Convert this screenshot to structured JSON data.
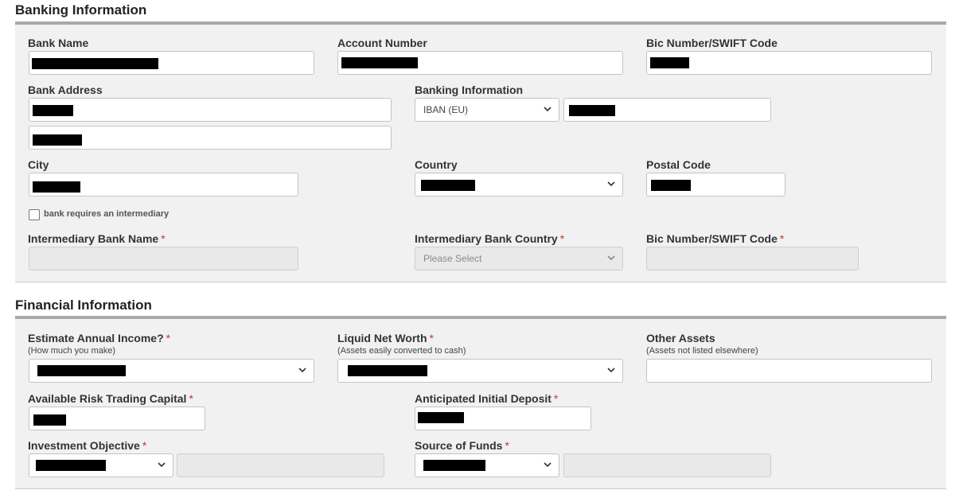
{
  "banking": {
    "title": "Banking Information",
    "bank_name_label": "Bank Name",
    "account_number_label": "Account Number",
    "bic_label": "Bic Number/SWIFT Code",
    "bank_address_label": "Bank Address",
    "banking_info_label": "Banking Information",
    "banking_info_type": "IBAN (EU)",
    "city_label": "City",
    "country_label": "Country",
    "postal_code_label": "Postal Code",
    "intermediary_checkbox_label": "bank requires an intermediary",
    "intermediary_checked": false,
    "intermediary_bank_name_label": "Intermediary Bank Name",
    "intermediary_bank_country_label": "Intermediary Bank Country",
    "intermediary_country_placeholder": "Please Select",
    "intermediary_bic_label": "Bic Number/SWIFT Code",
    "required_mark": "*"
  },
  "financial": {
    "title": "Financial Information",
    "annual_income_label": "Estimate Annual Income?",
    "annual_income_sub": "(How much you make)",
    "liquid_net_worth_label": "Liquid Net Worth",
    "liquid_net_worth_sub": "(Assets easily converted to cash)",
    "other_assets_label": "Other Assets",
    "other_assets_sub": "(Assets not listed elsewhere)",
    "risk_capital_label": "Available Risk Trading Capital",
    "initial_deposit_label": "Anticipated Initial Deposit",
    "investment_objective_label": "Investment Objective",
    "source_of_funds_label": "Source of Funds",
    "required_mark": "*"
  },
  "colors": {
    "panel_bg": "#f1f1f1",
    "panel_top_border": "#a9a9a9",
    "required": "#c0392b",
    "redaction": "#000000"
  }
}
